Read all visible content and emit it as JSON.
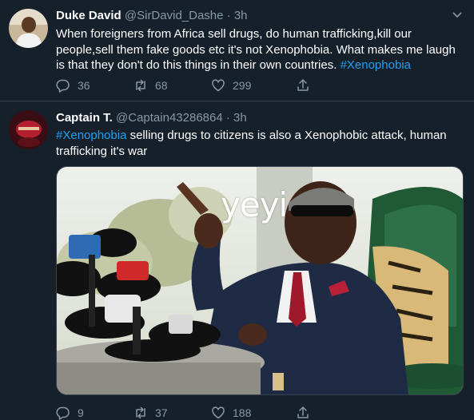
{
  "tweets": [
    {
      "name": "Duke David",
      "handle": "@SirDavid_Dashe",
      "sep": " · ",
      "time": "3h",
      "text_plain": "When foreigners from Africa sell drugs, do human trafficking,kill our people,sell them fake goods etc it's not Xenophobia. What makes me laugh is that they don't do this things in their own countries. ",
      "hashtag": "#Xenophobia",
      "replies": "36",
      "retweets": "68",
      "likes": "299"
    },
    {
      "name": "Captain T.",
      "handle": "@Captain43286864",
      "sep": " · ",
      "time": "3h",
      "hashtag": "#Xenophobia",
      "text_plain": " selling drugs to citizens is also a Xenophobic attack, human trafficking it's war",
      "media_caption": "yeyi",
      "replies": "9",
      "retweets": "37",
      "likes": "188"
    }
  ],
  "colors": {
    "background": "#15202b",
    "text": "#ffffff",
    "muted": "#8899a6",
    "accent": "#1da1f2",
    "divider": "#38444d"
  },
  "icons": [
    "reply-icon",
    "retweet-icon",
    "like-icon",
    "share-icon",
    "chevron-down-icon"
  ]
}
